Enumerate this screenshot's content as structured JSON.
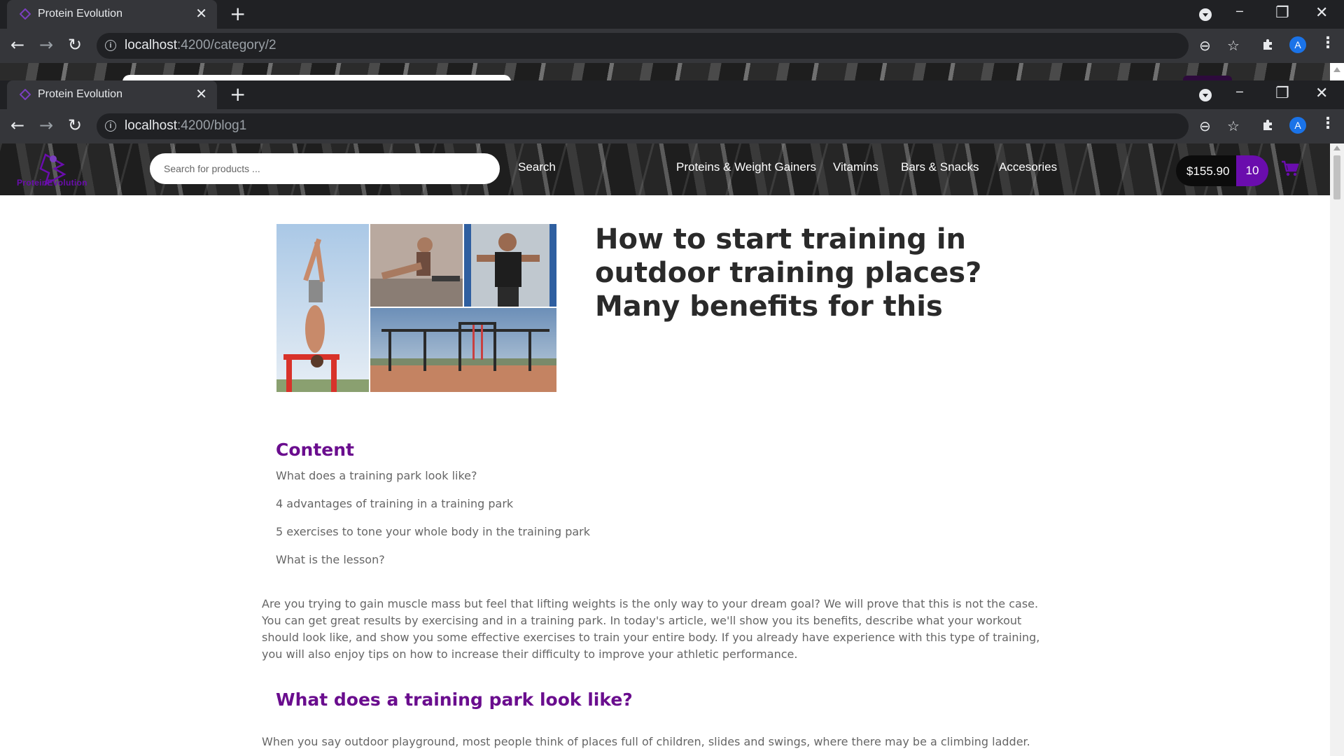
{
  "browser_back": {
    "tab_title": "Protein Evolution",
    "url_host": "localhost",
    "url_path": ":4200/category/2"
  },
  "browser_front": {
    "tab_title": "Protein Evolution",
    "url_host": "localhost",
    "url_path": ":4200/blog1",
    "profile_initial": "A"
  },
  "icons": {
    "back": "←",
    "forward": "→",
    "reload": "↻",
    "close": "✕",
    "new_tab": "+",
    "minimize": "─",
    "restore": "❐",
    "zoom": "⊖",
    "star": "☆",
    "menu": "⋮"
  },
  "header": {
    "logo_text": "ProteinEvolution",
    "search_placeholder": "Search for products ...",
    "search_label": "Search",
    "categories": [
      "Proteins & Weight Gainers",
      "Vitamins",
      "Bars & Snacks",
      "Accesories"
    ],
    "cart_total": "$155.90",
    "cart_count": "10"
  },
  "colors": {
    "accent": "#6a0dad",
    "heading": "#6a0d8e",
    "text": "#666666",
    "title": "#2a2a2a"
  },
  "article": {
    "title": "How to start training in outdoor training places? Many benefits for this",
    "toc_heading": "Content",
    "toc": [
      "What does a training park look like?",
      "4 advantages of training in a training park",
      "5 exercises to tone your whole body in the training park",
      "What is the lesson?"
    ],
    "intro": "Are you trying to gain muscle mass but feel that lifting weights is the only way to your dream goal? We will prove that this is not the case. You can get great results by exercising and in a training park. In today's article, we'll show you its benefits, describe what your workout should look like, and show you some effective exercises to train your entire body. If you already have experience with this type of training, you will also enjoy tips on how to increase their difficulty to improve your athletic performance.",
    "section1_heading": "What does a training park look like?",
    "section1_paragraph": "When you say outdoor playground, most people think of places full of children, slides and swings, where there may be a climbing ladder."
  }
}
